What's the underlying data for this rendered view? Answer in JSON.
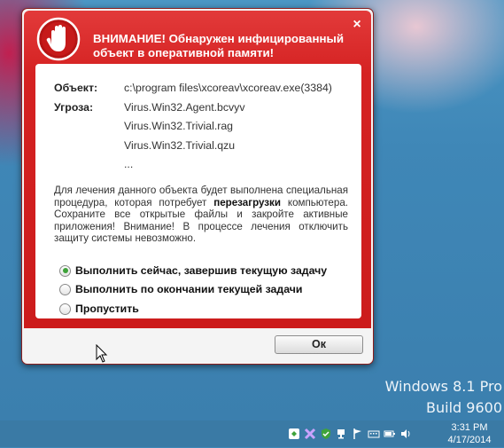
{
  "dialog": {
    "title": "ВНИМАНИЕ! Обнаружен инфицированный объект в оперативной памяти!",
    "object_label": "Объект:",
    "object_value": "c:\\program files\\xcoreav\\xcoreav.exe(3384)",
    "threat_label": "Угроза:",
    "threats": [
      "Virus.Win32.Agent.bcvyv",
      "Virus.Win32.Trivial.rag",
      "Virus.Win32.Trivial.qzu",
      "..."
    ],
    "description_part1": "Для лечения данного объекта будет выполнена специальная процедура, которая потребует ",
    "description_bold": "перезагрузки",
    "description_part2": " компьютера. Сохраните все открытые файлы и закройте активные приложения! Внимание! В процессе лечения отключить защиту системы невозможно.",
    "options": [
      {
        "label": "Выполнить сейчас, завершив текущую задачу",
        "checked": true
      },
      {
        "label": "Выполнить по окончании текущей задачи",
        "checked": false
      },
      {
        "label": "Пропустить",
        "checked": false
      }
    ],
    "ok_label": "Ок",
    "close_glyph": "×"
  },
  "desktop": {
    "watermark_line1": "Windows 8.1 Pro",
    "watermark_line2": "Build 9600"
  },
  "taskbar": {
    "tray_icons": [
      "recycle-icon",
      "av-icon",
      "shield-icon",
      "network-icon",
      "flag-icon",
      "keyboard-icon",
      "battery-icon",
      "volume-icon"
    ],
    "time": "3:31 PM",
    "date": "4/17/2014"
  },
  "colors": {
    "accent_red": "#d52222",
    "radio_green": "#3fa33a"
  }
}
